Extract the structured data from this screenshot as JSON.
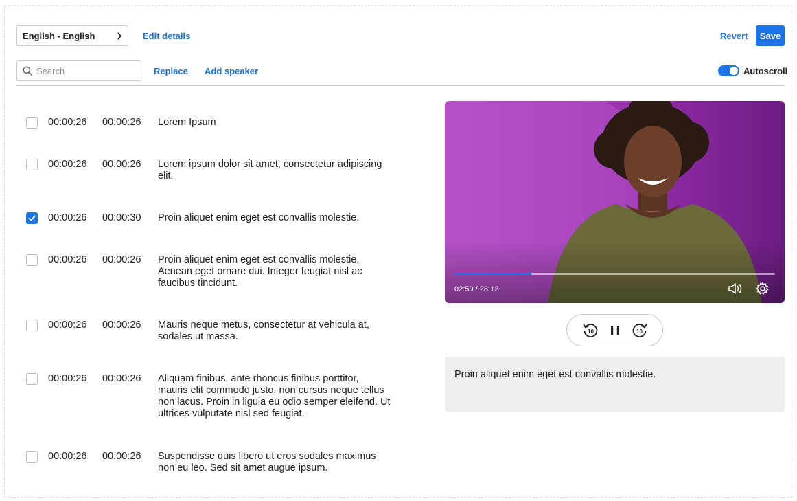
{
  "toolbar": {
    "language": "English - English",
    "edit_details": "Edit details",
    "revert": "Revert",
    "save": "Save",
    "search_placeholder": "Search",
    "replace": "Replace",
    "add_speaker": "Add speaker",
    "autoscroll_label": "Autoscroll",
    "autoscroll_on": true
  },
  "transcript": [
    {
      "start": "00:00:26",
      "end": "00:00:26",
      "text": "Lorem Ipsum",
      "checked": false
    },
    {
      "start": "00:00:26",
      "end": "00:00:26",
      "text": "Lorem ipsum dolor sit amet, consectetur adipiscing elit.",
      "checked": false
    },
    {
      "start": "00:00:26",
      "end": "00:00:30",
      "text": "Proin aliquet enim eget est convallis molestie.",
      "checked": true
    },
    {
      "start": "00:00:26",
      "end": "00:00:26",
      "text": "Proin aliquet enim eget est convallis molestie. Aenean eget ornare dui. Integer feugiat nisl ac faucibus tincidunt.",
      "checked": false
    },
    {
      "start": "00:00:26",
      "end": "00:00:26",
      "text": "Mauris neque metus, consectetur at vehicula at, sodales ut massa.",
      "checked": false
    },
    {
      "start": "00:00:26",
      "end": "00:00:26",
      "text": "Aliquam finibus, ante rhoncus finibus porttitor, mauris elit commodo justo, non cursus neque tellus non lacus. Proin in ligula eu odio semper eleifend. Ut ultrices vulputate nisl sed feugiat.",
      "checked": false
    },
    {
      "start": "00:00:26",
      "end": "00:00:26",
      "text": "Suspendisse quis libero ut eros sodales maximus non eu leo. Sed sit amet augue ipsum.",
      "checked": false
    }
  ],
  "player": {
    "time": "02:50 / 28:12",
    "progress_fraction": 0.24,
    "rewind_label": "10",
    "forward_label": "10"
  },
  "caption": {
    "text": "Proin aliquet enim eget est convallis molestie."
  },
  "colors": {
    "accent": "#1a73e8",
    "video_background": "#a43fbb"
  }
}
